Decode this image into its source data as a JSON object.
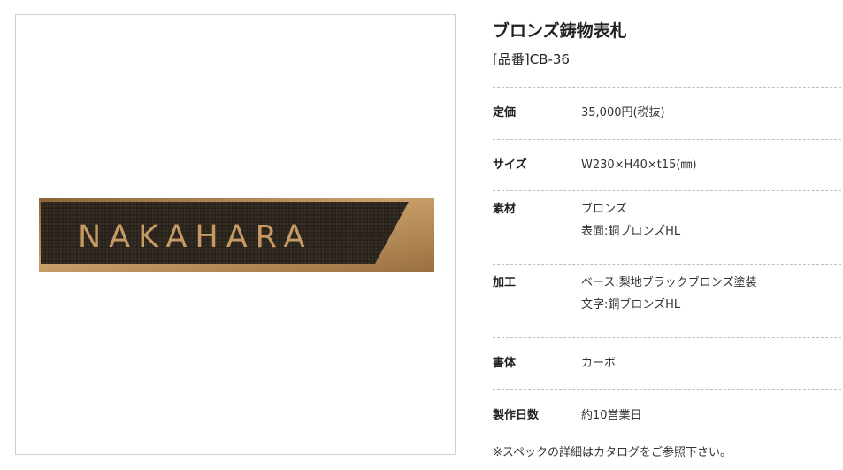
{
  "product": {
    "title": "ブロンズ鋳物表札",
    "code": "[品番]CB-36",
    "image": {
      "plate_text": "NAKAHARA",
      "colors": {
        "bronze": "#b88f5a",
        "dark": "#2a241d",
        "letters": "#c79a63"
      }
    }
  },
  "specs": [
    {
      "label": "定価",
      "lines": [
        "35,000円(税抜)"
      ]
    },
    {
      "label": "サイズ",
      "lines": [
        "W230×H40×t15(㎜)"
      ]
    },
    {
      "label": "素材",
      "lines": [
        "ブロンズ",
        "表面:銅ブロンズHL"
      ]
    },
    {
      "label": "加工",
      "lines": [
        "ベース:梨地ブラックブロンズ塗装",
        "文字:銅ブロンズHL"
      ]
    },
    {
      "label": "書体",
      "lines": [
        "カーボ"
      ]
    },
    {
      "label": "製作日数",
      "lines": [
        "約10営業日"
      ]
    }
  ],
  "note": "※スペックの詳細はカタログをご参照下さい。"
}
